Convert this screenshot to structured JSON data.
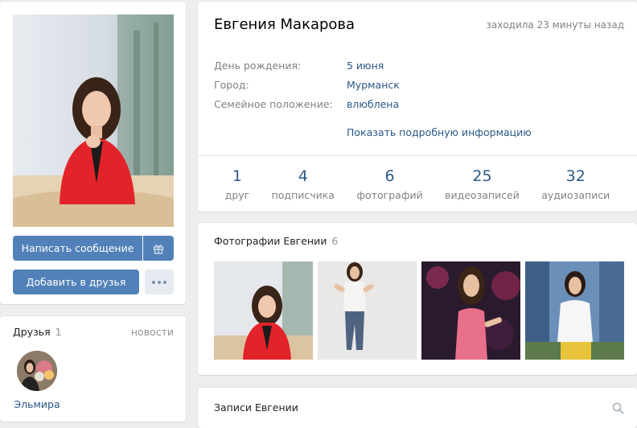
{
  "profile": {
    "name": "Евгения Макарова",
    "last_seen": "заходила 23 минуты назад",
    "info": [
      {
        "label": "День рождения:",
        "value": "5 июня"
      },
      {
        "label": "Город:",
        "value": "Мурманск"
      },
      {
        "label": "Семейное положение:",
        "value": "влюблена"
      }
    ],
    "more_link": "Показать подробную информацию",
    "counters": [
      {
        "num": "1",
        "label": "друг"
      },
      {
        "num": "4",
        "label": "подписчика"
      },
      {
        "num": "6",
        "label": "фотографий"
      },
      {
        "num": "25",
        "label": "видеозаписей"
      },
      {
        "num": "32",
        "label": "аудиозаписи"
      }
    ]
  },
  "actions": {
    "message": "Написать сообщение",
    "add_friend": "Добавить в друзья",
    "gift_icon": "gift-icon",
    "more_icon": "more-dots-icon"
  },
  "friends": {
    "title": "Друзья",
    "count": "1",
    "news_link": "новости",
    "items": [
      {
        "name": "Эльмира"
      }
    ]
  },
  "photos": {
    "title": "Фотографии Евгении",
    "count": "6"
  },
  "posts": {
    "title": "Записи Евгении",
    "search_icon": "search-icon"
  },
  "colors": {
    "accent": "#5181b8",
    "link": "#2a5885",
    "muted": "#828282",
    "background": "#edeef0"
  }
}
